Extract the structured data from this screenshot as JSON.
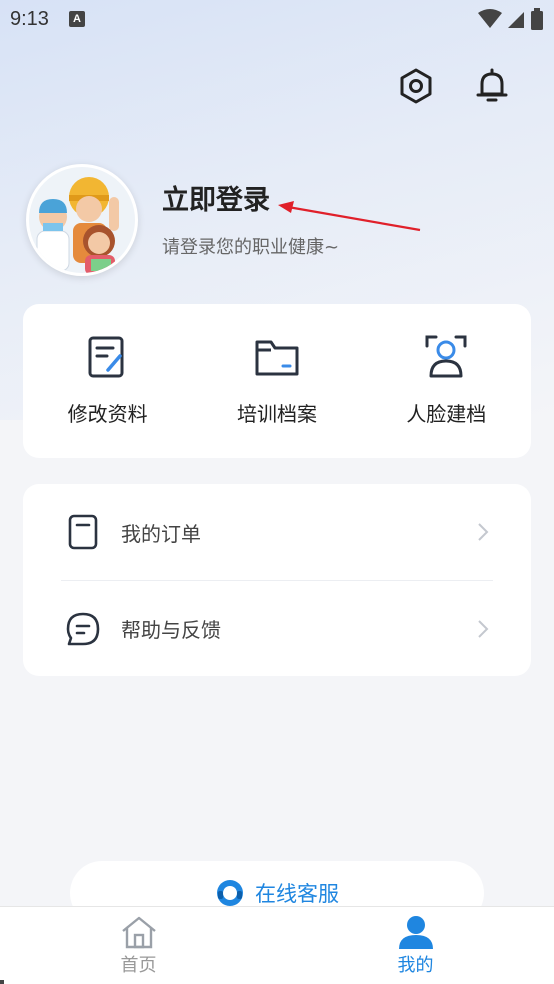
{
  "status_bar": {
    "time": "9:13",
    "notification_badge": "A"
  },
  "header": {
    "settings_icon": "settings-hexagon-icon",
    "bell_icon": "bell-icon"
  },
  "profile": {
    "title": "立即登录",
    "subtitle": "请登录您的职业健康~",
    "annotation_arrow_color": "#e0202a"
  },
  "quick_actions": [
    {
      "label": "修改资料",
      "icon": "edit-document-icon"
    },
    {
      "label": "培训档案",
      "icon": "folder-icon"
    },
    {
      "label": "人脸建档",
      "icon": "face-scan-icon"
    }
  ],
  "menu": [
    {
      "label": "我的订单",
      "icon": "order-icon"
    },
    {
      "label": "帮助与反馈",
      "icon": "feedback-icon"
    }
  ],
  "service": {
    "label": "在线客服",
    "icon": "headset-icon"
  },
  "tabs": [
    {
      "label": "首页",
      "icon": "home-icon",
      "active": false
    },
    {
      "label": "我的",
      "icon": "user-icon",
      "active": true
    }
  ],
  "colors": {
    "accent": "#1f86e0",
    "icon_stroke": "#2b3340",
    "accent_stroke": "#3a8be8"
  }
}
